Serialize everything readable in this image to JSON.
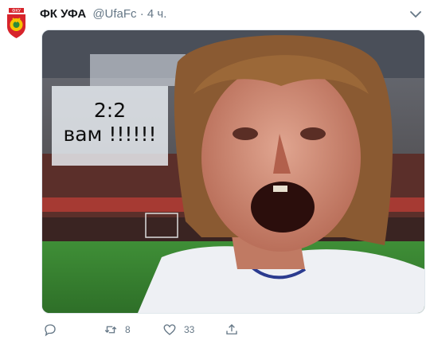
{
  "tweet": {
    "author_name": "ФК УФА",
    "author_handle": "@UfaFc",
    "separator": "·",
    "time": "4 ч.",
    "avatar_icon": "club-crest-icon",
    "menu_icon": "chevron-down-icon",
    "media": {
      "overlay_line1": "2:2",
      "overlay_line2": "вам !!!!!!"
    },
    "actions": {
      "reply_icon": "reply-icon",
      "retweet_icon": "retweet-icon",
      "retweet_count": "8",
      "like_icon": "heart-icon",
      "like_count": "33",
      "share_icon": "share-icon"
    }
  },
  "colors": {
    "secondary_text": "#657786",
    "crest_red": "#d7242b",
    "crest_yellow": "#f5c400"
  }
}
